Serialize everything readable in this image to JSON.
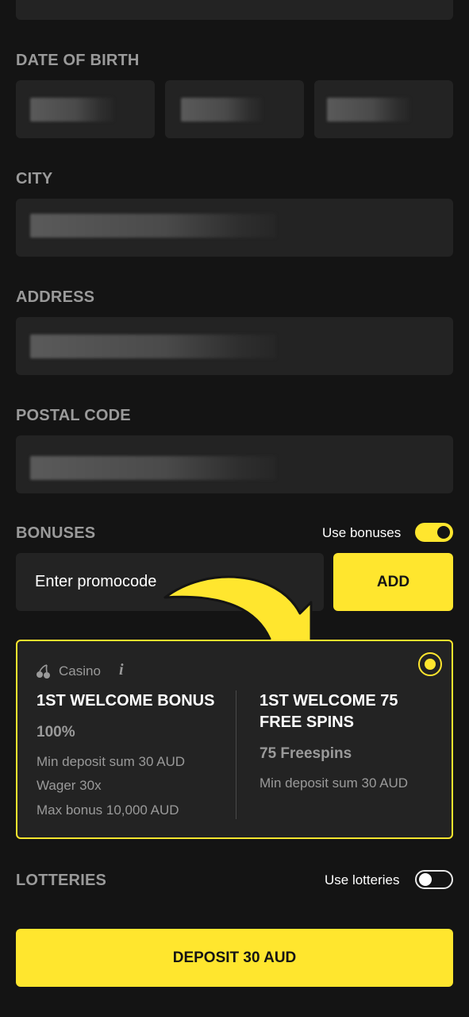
{
  "form": {
    "date_of_birth_label": "DATE OF BIRTH",
    "city_label": "CITY",
    "address_label": "ADDRESS",
    "postal_code_label": "POSTAL CODE"
  },
  "bonuses": {
    "label": "BONUSES",
    "toggle_label": "Use bonuses",
    "toggle_on": true,
    "promo_placeholder": "Enter promocode",
    "add_label": "ADD"
  },
  "bonus_card": {
    "category": "Casino",
    "info_icon": "i",
    "category_icon": "cherries-icon",
    "selected": true,
    "left": {
      "title": "1ST WELCOME BONUS",
      "subtitle": "100%",
      "lines": [
        "Min deposit sum 30 AUD",
        "Wager 30x",
        "Max bonus 10,000 AUD"
      ]
    },
    "right": {
      "title_line1": "1ST WELCOME 75",
      "title_line2": "FREE SPINS",
      "subtitle": "75 Freespins",
      "lines": [
        "Min deposit sum 30 AUD"
      ]
    }
  },
  "lotteries": {
    "label": "LOTTERIES",
    "toggle_label": "Use lotteries",
    "toggle_on": false
  },
  "deposit_button": {
    "label": "DEPOSIT 30 AUD"
  },
  "colors": {
    "background": "#141414",
    "field": "#232323",
    "accent": "#ffe62e",
    "label_grey": "#9a9a9a"
  }
}
